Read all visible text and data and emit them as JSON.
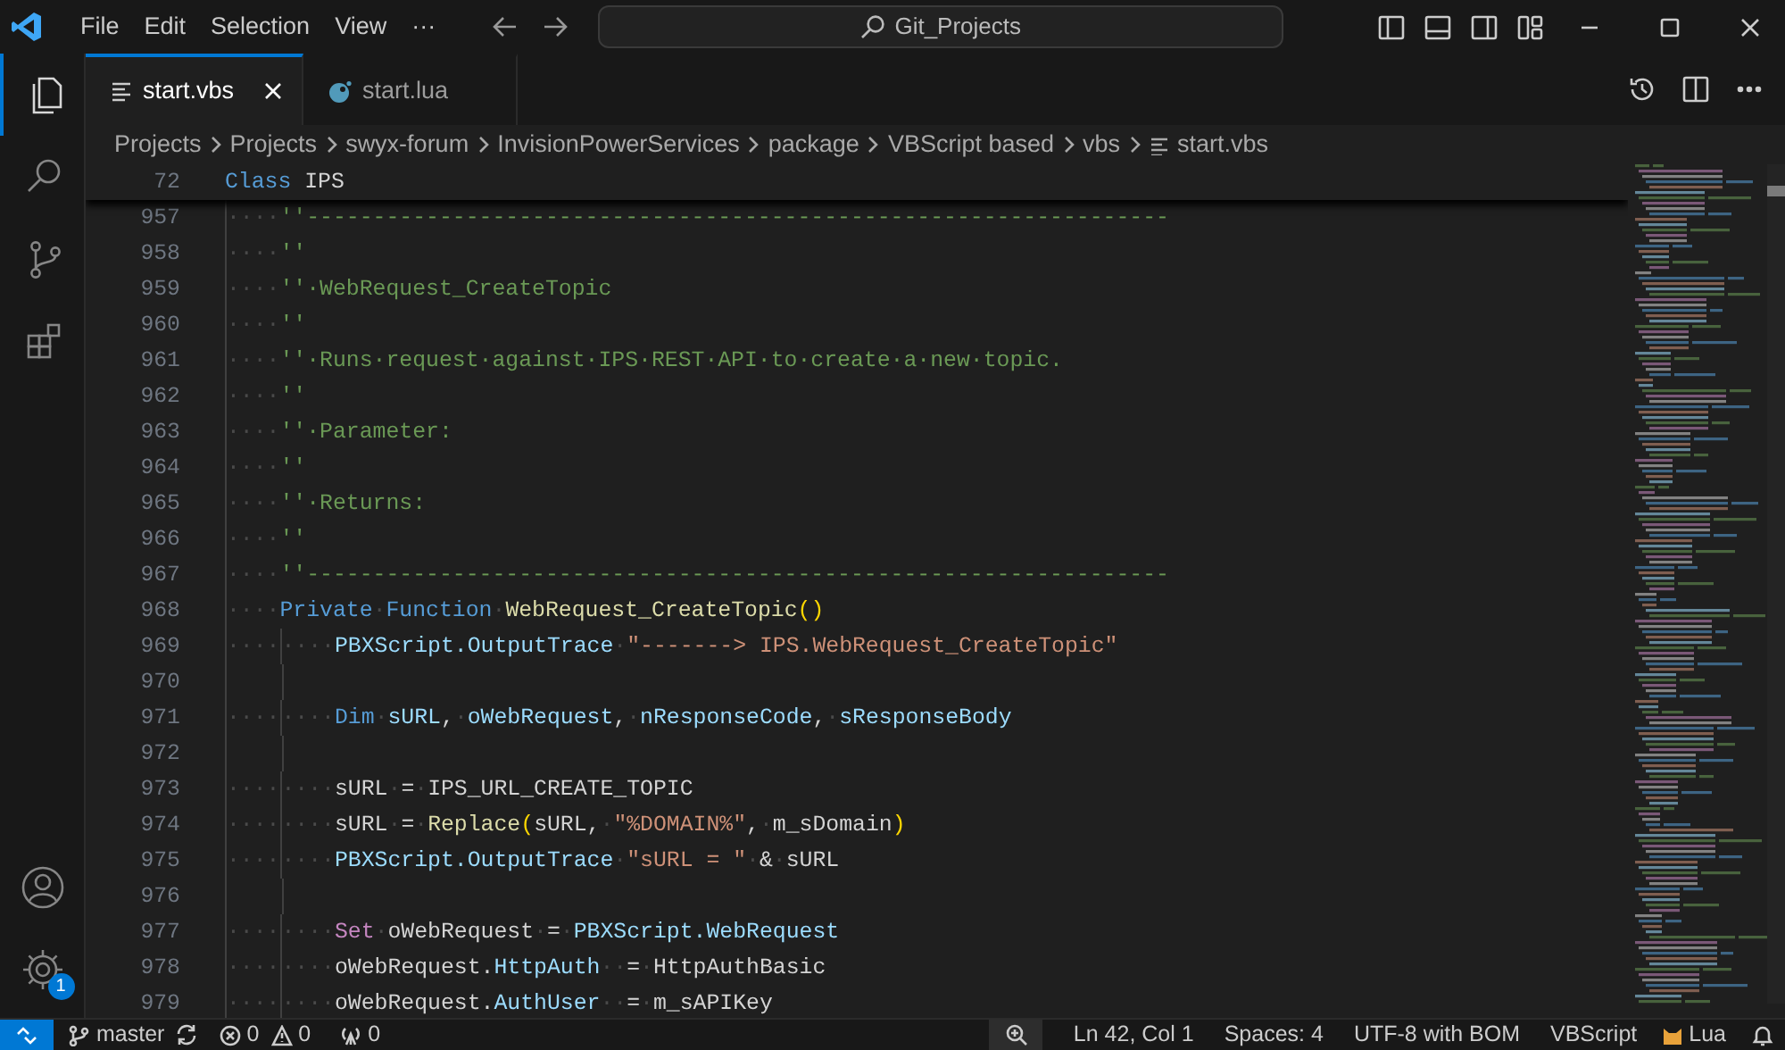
{
  "title_bar": {
    "menus": [
      "File",
      "Edit",
      "Selection",
      "View",
      "···"
    ],
    "search": "Git_Projects"
  },
  "activity_bar": {
    "items": [
      {
        "kind": "files",
        "selected": true
      },
      {
        "kind": "search",
        "selected": false
      },
      {
        "kind": "source-control",
        "selected": false
      },
      {
        "kind": "extensions",
        "selected": false
      }
    ],
    "settings_badge": "1"
  },
  "tabs": [
    {
      "label": "start.vbs",
      "kind": "vbs",
      "selected": true
    },
    {
      "label": "start.lua",
      "kind": "lua",
      "selected": false
    }
  ],
  "breadcrumb": [
    "Projects",
    "Projects",
    "swyx-forum",
    "InvisionPowerServices",
    "package",
    "VBScript based",
    "vbs",
    "start.vbs"
  ],
  "sticky_line": {
    "number": "72",
    "tokens": [
      {
        "kind": "kw",
        "text": "Class"
      },
      {
        "kind": "type",
        "text": "IPS"
      }
    ]
  },
  "lines": [
    {
      "number": "957",
      "indent": "····",
      "tokens": [
        {
          "kind": "comment",
          "text": "''-----------------------------------------------------------------"
        }
      ]
    },
    {
      "number": "958",
      "indent": "····",
      "tokens": [
        {
          "kind": "comment",
          "text": "''"
        }
      ]
    },
    {
      "number": "959",
      "indent": "····",
      "tokens": [
        {
          "kind": "comment",
          "text": "''·WebRequest_CreateTopic"
        }
      ]
    },
    {
      "number": "960",
      "indent": "····",
      "tokens": [
        {
          "kind": "comment",
          "text": "''"
        }
      ]
    },
    {
      "number": "961",
      "indent": "····",
      "tokens": [
        {
          "kind": "comment",
          "text": "''·Runs·request·against·IPS·REST·API·to·create·a·new·topic."
        }
      ]
    },
    {
      "number": "962",
      "indent": "····",
      "tokens": [
        {
          "kind": "comment",
          "text": "''"
        }
      ]
    },
    {
      "number": "963",
      "indent": "····",
      "tokens": [
        {
          "kind": "comment",
          "text": "''·Parameter:"
        }
      ]
    },
    {
      "number": "964",
      "indent": "····",
      "tokens": [
        {
          "kind": "comment",
          "text": "''"
        }
      ]
    },
    {
      "number": "965",
      "indent": "····",
      "tokens": [
        {
          "kind": "comment",
          "text": "''·Returns:"
        }
      ]
    },
    {
      "number": "966",
      "indent": "····",
      "tokens": [
        {
          "kind": "comment",
          "text": "''"
        }
      ]
    },
    {
      "number": "967",
      "indent": "····",
      "tokens": [
        {
          "kind": "comment",
          "text": "''-----------------------------------------------------------------"
        }
      ]
    },
    {
      "number": "968",
      "indent": "····",
      "tokens": [
        {
          "kind": "kw",
          "text": "Private"
        },
        {
          "kind": "ws",
          "text": "·"
        },
        {
          "kind": "kw",
          "text": "Function"
        },
        {
          "kind": "ws",
          "text": "·"
        },
        {
          "kind": "fn",
          "text": "WebRequest_CreateTopic"
        },
        {
          "kind": "paren",
          "text": "()"
        }
      ]
    },
    {
      "number": "969",
      "indent": "········",
      "tokens": [
        {
          "kind": "var",
          "text": "PBXScript.OutputTrace"
        },
        {
          "kind": "ws",
          "text": "·"
        },
        {
          "kind": "str",
          "text": "\"-------> IPS.WebRequest_CreateTopic\""
        }
      ]
    },
    {
      "number": "970"
    },
    {
      "number": "971",
      "indent": "········",
      "tokens": [
        {
          "kind": "kw",
          "text": "Dim"
        },
        {
          "kind": "ws",
          "text": "·"
        },
        {
          "kind": "var",
          "text": "sURL"
        },
        {
          "kind": "plain",
          "text": ","
        },
        {
          "kind": "ws",
          "text": "·"
        },
        {
          "kind": "var",
          "text": "oWebRequest"
        },
        {
          "kind": "plain",
          "text": ","
        },
        {
          "kind": "ws",
          "text": "·"
        },
        {
          "kind": "var",
          "text": "nResponseCode"
        },
        {
          "kind": "plain",
          "text": ","
        },
        {
          "kind": "ws",
          "text": "·"
        },
        {
          "kind": "var",
          "text": "sResponseBody"
        }
      ]
    },
    {
      "number": "972"
    },
    {
      "number": "973",
      "indent": "········",
      "tokens": [
        {
          "kind": "plain",
          "text": "sURL"
        },
        {
          "kind": "ws",
          "text": "·"
        },
        {
          "kind": "plain",
          "text": "="
        },
        {
          "kind": "ws",
          "text": "·"
        },
        {
          "kind": "plain",
          "text": "IPS_URL_CREATE_TOPIC"
        }
      ]
    },
    {
      "number": "974",
      "indent": "········",
      "tokens": [
        {
          "kind": "plain",
          "text": "sURL"
        },
        {
          "kind": "ws",
          "text": "·"
        },
        {
          "kind": "plain",
          "text": "="
        },
        {
          "kind": "ws",
          "text": "·"
        },
        {
          "kind": "fn",
          "text": "Replace"
        },
        {
          "kind": "paren",
          "text": "("
        },
        {
          "kind": "plain",
          "text": "sURL,"
        },
        {
          "kind": "ws",
          "text": "·"
        },
        {
          "kind": "str",
          "text": "\"%DOMAIN%\""
        },
        {
          "kind": "plain",
          "text": ","
        },
        {
          "kind": "ws",
          "text": "·"
        },
        {
          "kind": "plain",
          "text": "m_sDomain"
        },
        {
          "kind": "paren",
          "text": ")"
        }
      ]
    },
    {
      "number": "975",
      "indent": "········",
      "tokens": [
        {
          "kind": "var",
          "text": "PBXScript.OutputTrace"
        },
        {
          "kind": "ws",
          "text": "·"
        },
        {
          "kind": "str",
          "text": "\"sURL = \""
        },
        {
          "kind": "ws",
          "text": "·"
        },
        {
          "kind": "plain",
          "text": "&"
        },
        {
          "kind": "ws",
          "text": "·"
        },
        {
          "kind": "plain",
          "text": "sURL"
        }
      ]
    },
    {
      "number": "976"
    },
    {
      "number": "977",
      "indent": "········",
      "tokens": [
        {
          "kind": "ctrl",
          "text": "Set"
        },
        {
          "kind": "ws",
          "text": "·"
        },
        {
          "kind": "plain",
          "text": "oWebRequest"
        },
        {
          "kind": "ws",
          "text": "·"
        },
        {
          "kind": "plain",
          "text": "="
        },
        {
          "kind": "ws",
          "text": "·"
        },
        {
          "kind": "var",
          "text": "PBXScript.WebRequest"
        }
      ]
    },
    {
      "number": "978",
      "indent": "········",
      "tokens": [
        {
          "kind": "plain",
          "text": "oWebRequest."
        },
        {
          "kind": "var",
          "text": "HttpAuth"
        },
        {
          "kind": "ws",
          "text": "··"
        },
        {
          "kind": "plain",
          "text": "="
        },
        {
          "kind": "ws",
          "text": "·"
        },
        {
          "kind": "plain",
          "text": "HttpAuthBasic"
        }
      ]
    },
    {
      "number": "979",
      "indent": "········",
      "tokens": [
        {
          "kind": "plain",
          "text": "oWebRequest."
        },
        {
          "kind": "var",
          "text": "AuthUser"
        },
        {
          "kind": "ws",
          "text": "··"
        },
        {
          "kind": "plain",
          "text": "="
        },
        {
          "kind": "ws",
          "text": "·"
        },
        {
          "kind": "plain",
          "text": "m_sAPIKey"
        }
      ]
    }
  ],
  "status_bar": {
    "branch": "master",
    "errors": "0",
    "warnings": "0",
    "ports": "0",
    "position": "Ln 42, Col 1",
    "spaces": "Spaces: 4",
    "encoding": "UTF-8 with BOM",
    "language": "VBScript",
    "lua": "Lua"
  }
}
